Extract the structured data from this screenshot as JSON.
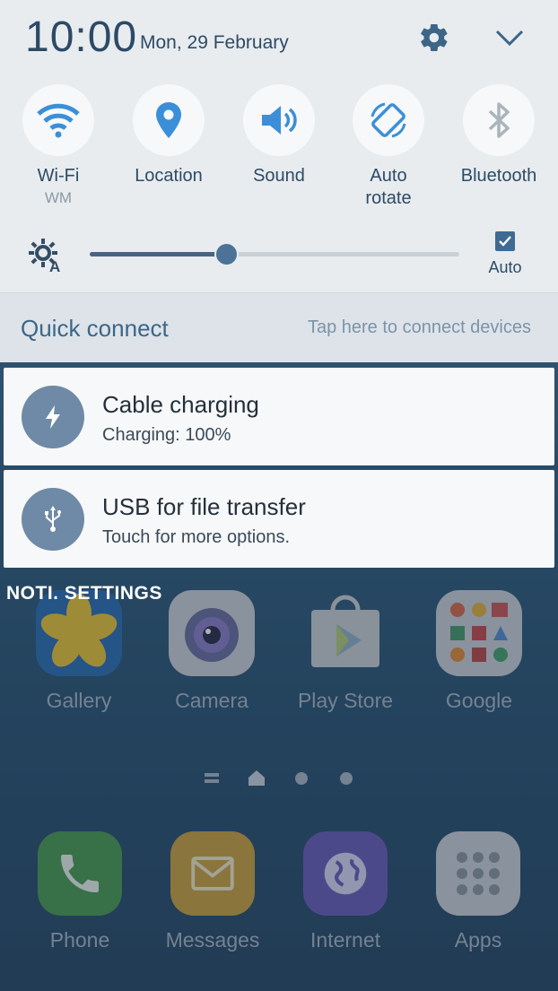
{
  "status": {
    "time": "10:00",
    "date": "Mon, 29 February"
  },
  "header": {
    "settings_icon": "gear-icon",
    "collapse_icon": "chevron-down-icon"
  },
  "toggles": [
    {
      "label": "Wi-Fi",
      "sub": "WM",
      "icon": "wifi-icon"
    },
    {
      "label": "Location",
      "sub": "",
      "icon": "location-pin-icon"
    },
    {
      "label": "Sound",
      "sub": "",
      "icon": "speaker-icon"
    },
    {
      "label": "Auto\nrotate",
      "sub": "",
      "icon": "auto-rotate-icon"
    },
    {
      "label": "Bluetooth",
      "sub": "",
      "icon": "bluetooth-icon"
    }
  ],
  "brightness": {
    "level": 0.37,
    "auto_label": "Auto",
    "auto_checked": true
  },
  "quick_connect": {
    "title": "Quick connect",
    "hint": "Tap here to connect devices"
  },
  "notifications": [
    {
      "title": "Cable charging",
      "text": "Charging: 100%",
      "icon": "lightning-icon"
    },
    {
      "title": "USB for file transfer",
      "text": "Touch for more options.",
      "icon": "usb-icon"
    }
  ],
  "noti_settings_label": "NOTI. SETTINGS",
  "apps": [
    {
      "label": "Gallery"
    },
    {
      "label": "Camera"
    },
    {
      "label": "Play Store"
    },
    {
      "label": "Google"
    }
  ],
  "dock": [
    {
      "label": "Phone"
    },
    {
      "label": "Messages"
    },
    {
      "label": "Internet"
    },
    {
      "label": "Apps"
    }
  ],
  "colors": {
    "accent": "#3f6a92",
    "panel": "#e8ecef",
    "text": "#2d4a66"
  }
}
